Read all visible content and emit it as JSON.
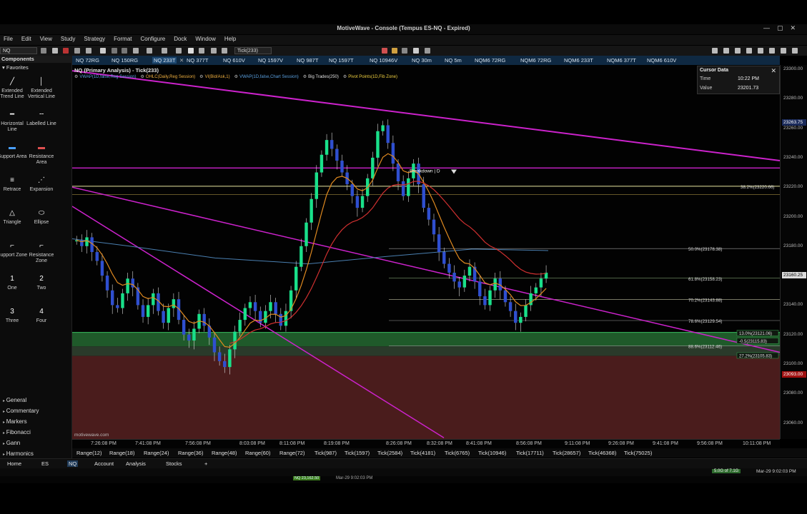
{
  "window": {
    "title": "MotiveWave - Console (Tempus ES-NQ - Expired)",
    "controls": [
      "—",
      "▢",
      "✕"
    ]
  },
  "menu": [
    "File",
    "Edit",
    "View",
    "Study",
    "Strategy",
    "Format",
    "Configure",
    "Dock",
    "Window",
    "Help"
  ],
  "toolbar": {
    "symbol": "NQ",
    "bar_size": "Tick(233)"
  },
  "sidebar": {
    "header": "Components",
    "favorites": "Favorites",
    "tools": [
      {
        "label": "Extended Trend Line",
        "icon": "trend-line-icon",
        "glyph": "╱"
      },
      {
        "label": "Extended Vertical Line",
        "icon": "vertical-line-icon",
        "glyph": "│"
      },
      {
        "label": "Horizontal Line",
        "icon": "horizontal-line-icon",
        "glyph": "━"
      },
      {
        "label": "Labelled Line",
        "icon": "labelled-line-icon",
        "glyph": "╌"
      },
      {
        "label": "Support Area",
        "icon": "support-area-icon",
        "glyph": "▬"
      },
      {
        "label": "Resistance Area",
        "icon": "resistance-area-icon",
        "glyph": "▬"
      },
      {
        "label": "Retrace",
        "icon": "retrace-icon",
        "glyph": "≡"
      },
      {
        "label": "Expansion",
        "icon": "expansion-icon",
        "glyph": "⋰"
      },
      {
        "label": "Triangle",
        "icon": "triangle-icon",
        "glyph": "△"
      },
      {
        "label": "Ellipse",
        "icon": "ellipse-icon",
        "glyph": "⬭"
      },
      {
        "label": "Support Zone",
        "icon": "support-zone-icon",
        "glyph": "⌐"
      },
      {
        "label": "Resistance Zone",
        "icon": "resistance-zone-icon",
        "glyph": "⌐"
      },
      {
        "label": "One",
        "icon": "one-icon",
        "glyph": "1"
      },
      {
        "label": "Two",
        "icon": "two-icon",
        "glyph": "2"
      },
      {
        "label": "Three",
        "icon": "three-icon",
        "glyph": "3"
      },
      {
        "label": "Four",
        "icon": "four-icon",
        "glyph": "4"
      }
    ],
    "sections": [
      "General",
      "Commentary",
      "Markers",
      "Fibonacci",
      "Gann",
      "Harmonics"
    ]
  },
  "chart_tabs": [
    "NQ 72RG",
    "NQ 150RG",
    "NQ 233T",
    "NQ 377T",
    "NQ 610V",
    "NQ 1597V",
    "NQ 987T",
    "NQ 1597T",
    "NQ 10946V",
    "NQ 30m",
    "NQ 5m",
    "NQM6 72RG",
    "NQM6 72RG",
    "NQM6 233T",
    "NQM6 377T",
    "NQM6 610V"
  ],
  "chart": {
    "header": "NQ (Primary Analysis) - Tick(233)",
    "indicators": [
      {
        "text": "VWAP(1D,false,Reg Session)",
        "color": "#5aa0e0"
      },
      {
        "text": "OHLC(Daily,Reg Session)",
        "color": "#f0b040"
      },
      {
        "text": "VI(Bid/Ask,1)",
        "color": "#f0b040"
      },
      {
        "text": "VWAP(1D,false,Chart Session)",
        "color": "#5aa0e0"
      },
      {
        "text": "Big Trades(250)",
        "color": "#e0e0e0"
      },
      {
        "text": "Pivot Points(1D,Fib Zone)",
        "color": "#f0d040"
      }
    ],
    "watermark": "motivewave.com",
    "annotation": "Breakdown | D"
  },
  "cursor_data": {
    "title": "Cursor Data",
    "rows": [
      {
        "label": "Time",
        "value": "10:22 PM"
      },
      {
        "label": "Value",
        "value": "23201.73"
      }
    ]
  },
  "fib_levels": [
    {
      "label": "38.2%(23220.66)",
      "price": 23220.66,
      "color": "#e8e6a0"
    },
    {
      "label": "50.0%(23178.38)",
      "price": 23178.38,
      "color": "#9a9a9a"
    },
    {
      "label": "61.8%(23158.23)",
      "price": 23158.23,
      "color": "#9ac08a"
    },
    {
      "label": "70.2%(23143.88)",
      "price": 23143.88,
      "color": "#c0c0a0"
    },
    {
      "label": "78.6%(23129.54)",
      "price": 23129.54,
      "color": "#9a9a9a"
    },
    {
      "label": "88.6%(23112.46)",
      "price": 23112.46,
      "color": "#9a9a9a"
    }
  ],
  "zone_labels": [
    {
      "label": "13.0%(23121.06)",
      "price": 23121.06
    },
    {
      "label": "-0.5(23115.83)",
      "price": 23115.83
    },
    {
      "label": "27.2%(23105.83)",
      "price": 23105.83
    }
  ],
  "price_axis": {
    "ticks": [
      "23300.00",
      "23280.00",
      "23260.00",
      "23240.00",
      "23220.00",
      "23200.00",
      "23180.00",
      "23160.00",
      "23140.00",
      "23120.00",
      "23100.00",
      "23080.00",
      "23060.00"
    ],
    "current": "23160.25",
    "highlight": "23263.75",
    "low_tag": "23093.00"
  },
  "time_axis": [
    "7:26:08 PM",
    "7:41:08 PM",
    "7:56:08 PM",
    "8:03:08 PM",
    "8:11:08 PM",
    "8:19:08 PM",
    "8:26:08 PM",
    "8:32:08 PM",
    "8:41:08 PM",
    "8:56:08 PM",
    "9:11:08 PM",
    "9:26:08 PM",
    "9:41:08 PM",
    "9:56:08 PM",
    "10:11:08 PM"
  ],
  "bar_sizes": [
    "Range(12)",
    "Range(18)",
    "Range(24)",
    "Range(36)",
    "Range(48)",
    "Range(60)",
    "Range(72)",
    "Tick(987)",
    "Tick(1597)",
    "Tick(2584)",
    "Tick(4181)",
    "Tick(6765)",
    "Tick(10946)",
    "Tick(17711)",
    "Tick(28657)",
    "Tick(46368)",
    "Tick(75025)"
  ],
  "workspace_tabs": [
    "Home",
    "ES",
    "NQ",
    "Account",
    "Analysis",
    "Stocks",
    "+"
  ],
  "status": {
    "memory": "5.0G of 7.1G",
    "datetime": "Mar-29 9:02:03 PM",
    "taskbar_time": "Mar-29 9:02:03 PM",
    "taskbar_left": "NQ 23,162.50"
  },
  "colors": {
    "up_candle": "#19e08a",
    "down_candle": "#2f4fd0",
    "trendline": "#cc22cc",
    "orange_line": "#e08a20",
    "red_line": "#d03030",
    "vwap_line": "#4a7fb0",
    "support_zone": "#1f5a2a",
    "resistance_zone": "#4a1c1c"
  }
}
